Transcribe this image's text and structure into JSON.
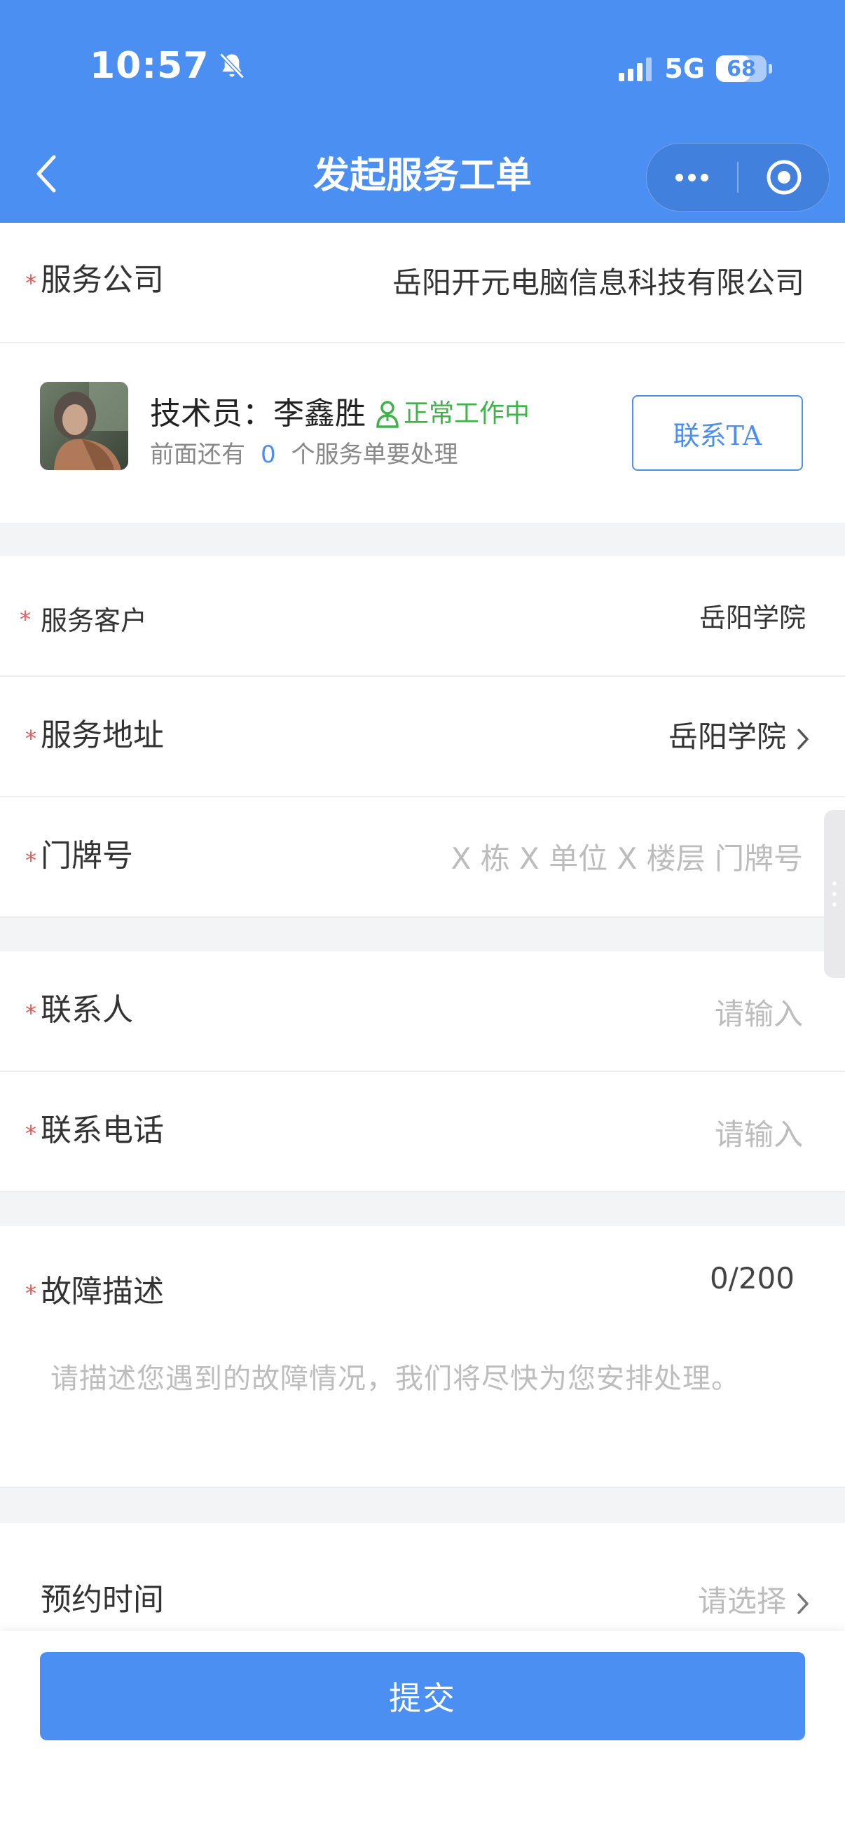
{
  "status_bar": {
    "time": "10:57",
    "network": "5G",
    "battery": "68",
    "battery_level": 0.68
  },
  "nav": {
    "title": "发起服务工单"
  },
  "company": {
    "label": "服务公司",
    "value": "岳阳开元电脑信息科技有限公司"
  },
  "technician": {
    "title_prefix": "技术员：",
    "name": "李鑫胜",
    "status": "正常工作中",
    "queue_prefix": "前面还有",
    "queue_count": "0",
    "queue_suffix": "个服务单要处理",
    "contact_label": "联系TA"
  },
  "customer": {
    "label": "服务客户",
    "value": "岳阳学院"
  },
  "address": {
    "label": "服务地址",
    "value": "岳阳学院"
  },
  "door": {
    "label": "门牌号",
    "placeholder": "X 栋 X 单位 X 楼层 门牌号"
  },
  "contact_person": {
    "label": "联系人",
    "placeholder": "请输入"
  },
  "contact_phone": {
    "label": "联系电话",
    "placeholder": "请输入"
  },
  "fault": {
    "label": "故障描述",
    "counter": "0/200",
    "placeholder": "请描述您遇到的故障情况，我们将尽快为您安排处理。"
  },
  "appointment": {
    "label": "预约时间",
    "placeholder": "请选择"
  },
  "submit": {
    "label": "提交"
  },
  "colors": {
    "primary": "#4c8ff2",
    "required": "#e85a5a",
    "status_green": "#3fb24a",
    "placeholder": "#bcbcbc",
    "background": "#f3f4f6"
  },
  "icons": {
    "back": "chevron-left-icon",
    "more": "more-dots-icon",
    "close": "target-circle-icon",
    "mute": "bell-slash-icon",
    "person": "person-icon",
    "chevron": "chevron-right-icon"
  }
}
